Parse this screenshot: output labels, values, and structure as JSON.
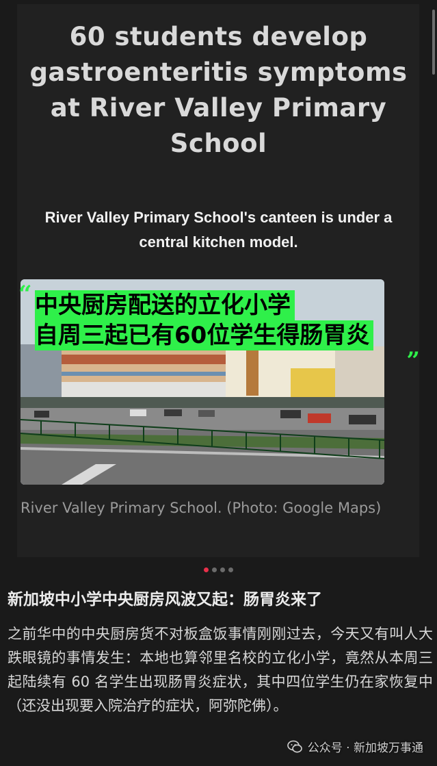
{
  "image_card": {
    "headline": "60 students develop gastroenteritis symptoms at River Valley Primary School",
    "subhead": "River Valley Primary School's canteen is under a central kitchen model.",
    "overlay_line1": "中央厨房配送的立化小学",
    "overlay_line2": "自周三起已有60位学生得肠胃炎",
    "quote_open": "“",
    "quote_close": "„",
    "caption": "River Valley Primary School. (Photo: Google Maps)"
  },
  "carousel": {
    "count": 4,
    "active_index": 0,
    "active_color": "#e8304a"
  },
  "article": {
    "title": "新加坡中小学中央厨房风波又起：肠胃炎来了",
    "body": "之前华中的中央厨房货不对板盒饭事情刚刚过去，今天又有叫人大跌眼镜的事情发生：本地也算邻里名校的立化小学，竟然从本周三起陆续有 60 名学生出现肠胃炎症状，其中四位学生仍在家恢复中（还没出现要入院治疗的症状，阿弥陀佛）。"
  },
  "watermark": {
    "icon": "wechat-icon",
    "label": "公众号 · 新加坡万事通"
  },
  "colors": {
    "highlight": "#2ff04a",
    "background": "#1a1a1a",
    "card": "#212121"
  }
}
